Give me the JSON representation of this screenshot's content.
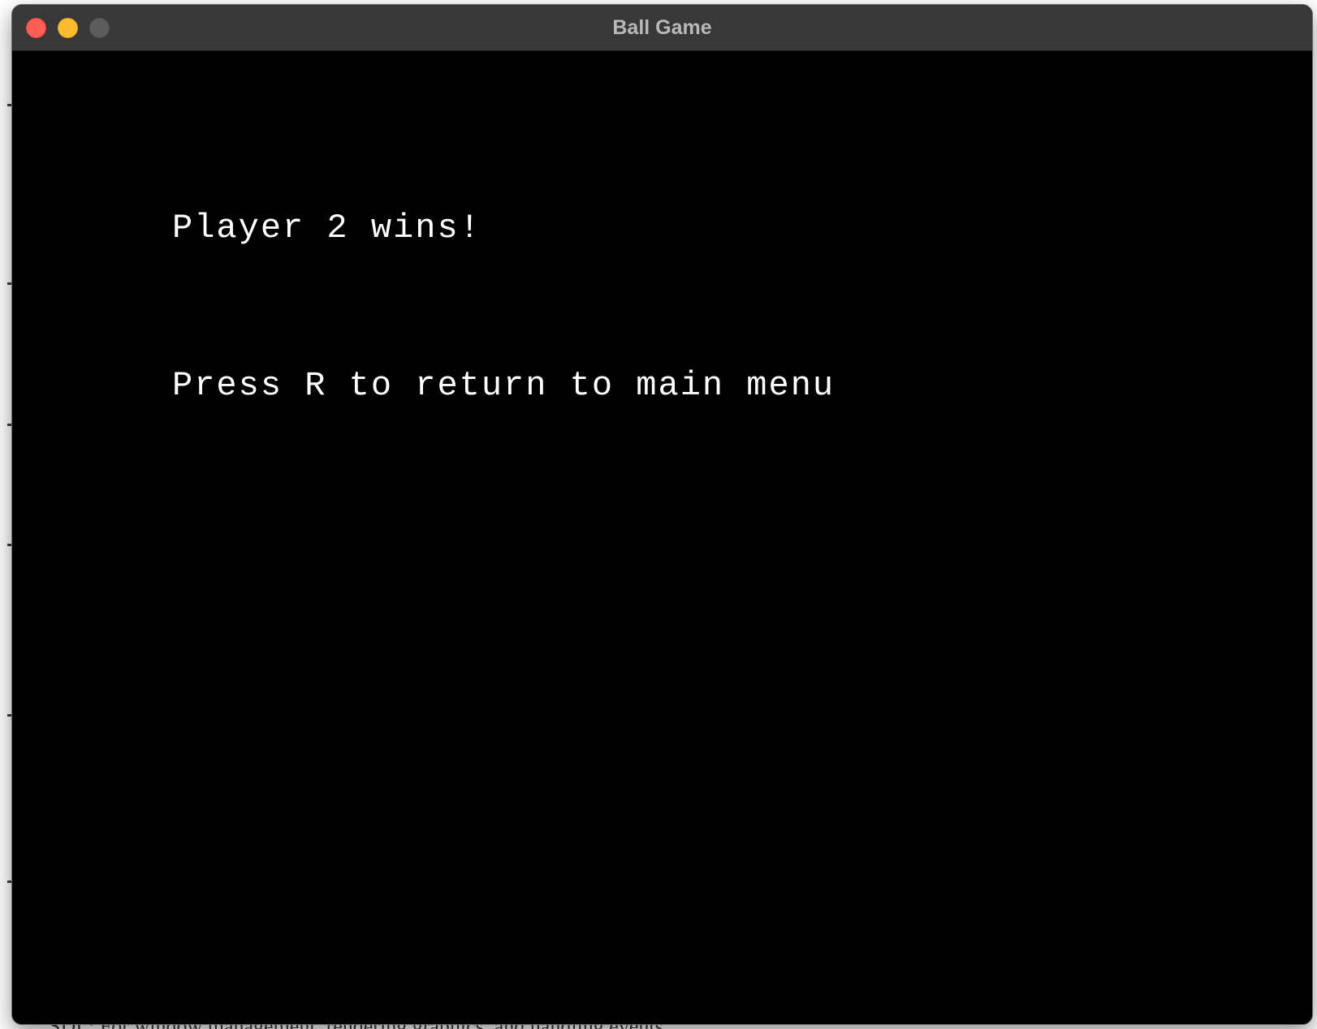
{
  "window": {
    "title": "Ball Game",
    "controls": {
      "close": "close",
      "minimize": "minimize",
      "zoom": "zoom"
    }
  },
  "game": {
    "winner_message": "Player 2 wins!",
    "prompt": "Press R to return to main menu"
  },
  "background_window": {
    "bottom_text": "SDL: For window management, rendering graphics, and handling events."
  },
  "colors": {
    "game_background": "#000000",
    "game_text": "#ffffff",
    "titlebar": "#383838",
    "title_text": "#b9b9b9",
    "close": "#ff5f57",
    "minimize": "#febc2e",
    "zoom_disabled": "#5d5d5d"
  }
}
